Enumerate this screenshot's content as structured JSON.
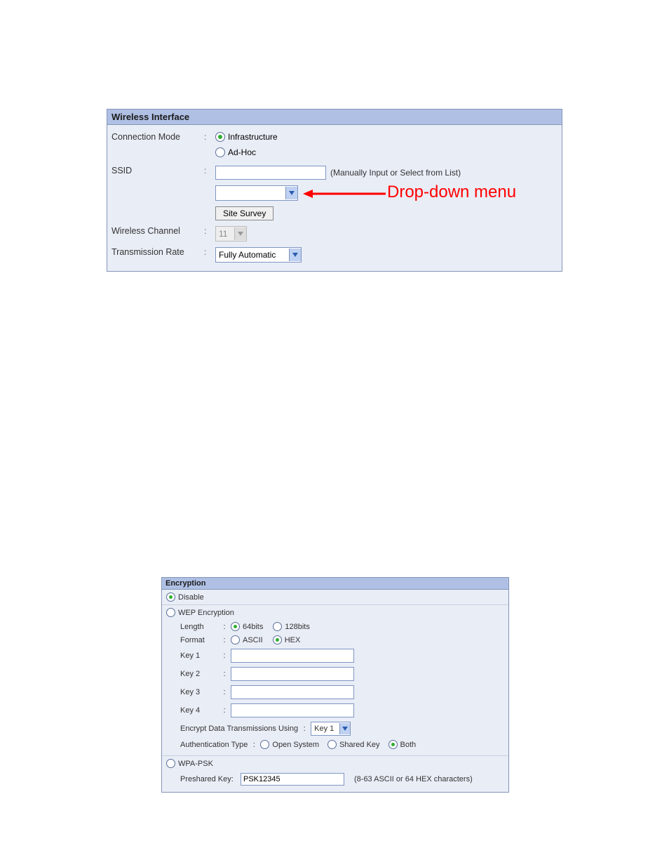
{
  "panel1": {
    "title": "Wireless Interface",
    "connection_mode": {
      "label": "Connection Mode",
      "opt_infra": "Infrastructure",
      "opt_adhoc": "Ad-Hoc"
    },
    "ssid": {
      "label": "SSID",
      "hint": "(Manually Input or Select from List)",
      "input_value": "",
      "select_value": "",
      "site_survey": "Site Survey"
    },
    "channel": {
      "label": "Wireless Channel",
      "value": "11"
    },
    "rate": {
      "label": "Transmission Rate",
      "value": "Fully Automatic"
    }
  },
  "annotation": {
    "text": "Drop-down menu"
  },
  "panel2": {
    "title": "Encryption",
    "disable": {
      "label": "Disable"
    },
    "wep": {
      "label": "WEP Encryption",
      "length_label": "Length",
      "len64": "64bits",
      "len128": "128bits",
      "format_label": "Format",
      "fmt_ascii": "ASCII",
      "fmt_hex": "HEX",
      "key1": "Key 1",
      "key2": "Key 2",
      "key3": "Key 3",
      "key4": "Key 4",
      "encrypt_using_label": "Encrypt Data Transmissions Using",
      "encrypt_using_value": "Key 1",
      "auth_label": "Authentication Type",
      "auth_open": "Open System",
      "auth_shared": "Shared Key",
      "auth_both": "Both"
    },
    "wpa": {
      "label": "WPA-PSK",
      "psk_label": "Preshared Key:",
      "psk_value": "PSK12345",
      "psk_hint": "(8-63 ASCII or 64 HEX characters)"
    }
  }
}
